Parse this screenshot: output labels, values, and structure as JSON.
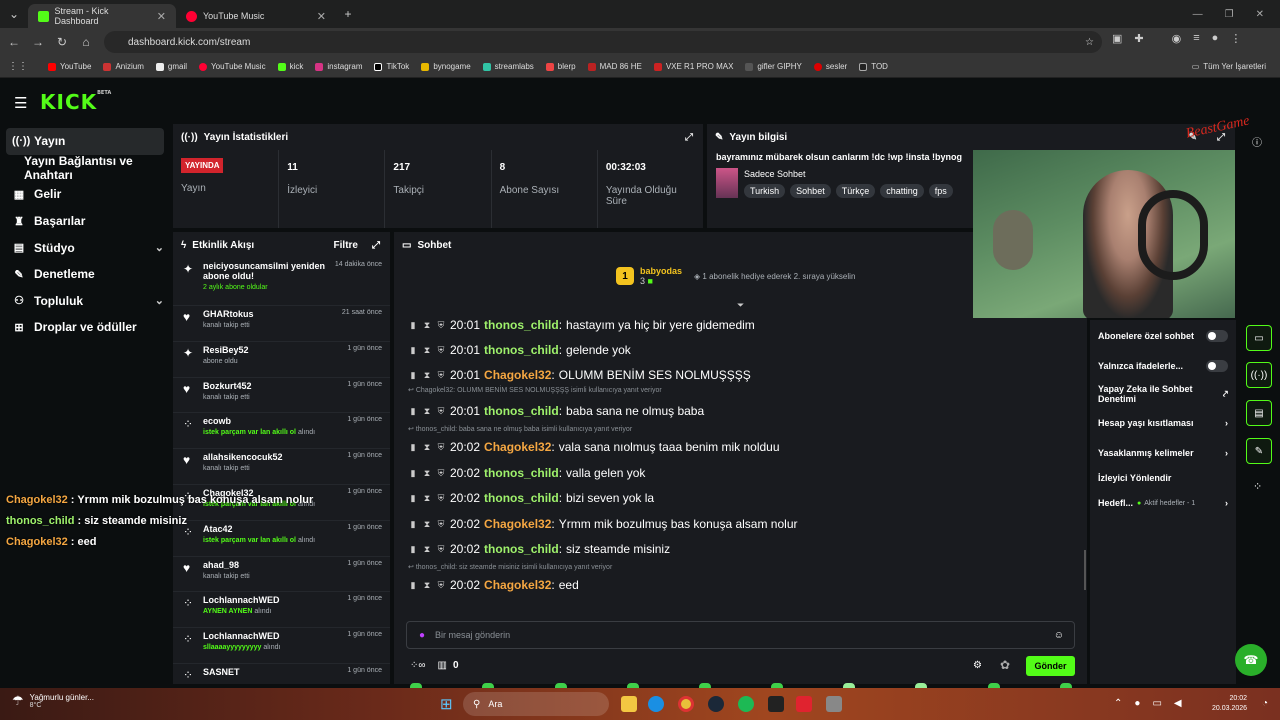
{
  "browser": {
    "tabs": [
      {
        "title": "Stream - Kick Dashboard"
      },
      {
        "title": "YouTube Music"
      }
    ],
    "url": "dashboard.kick.com/stream",
    "bookmarks": [
      "YouTube",
      "Anizium",
      "gmail",
      "YouTube Music",
      "kick",
      "instagram",
      "TikTok",
      "bynogame",
      "streamlabs",
      "blerp",
      "MAD 86 HE",
      "VXE R1 PRO MAX",
      "gifler GIPHY",
      "sesler",
      "TOD"
    ],
    "all_bookmarks": "Tüm Yer İşaretleri"
  },
  "logo": {
    "text": "KICK",
    "beta": "BETA"
  },
  "nav": {
    "items": [
      {
        "label": "Yayın",
        "icon": "broadcast-icon"
      },
      {
        "label": "Yayın Bağlantısı ve Anahtarı",
        "icon": ""
      },
      {
        "label": "Gelir",
        "icon": "revenue-icon"
      },
      {
        "label": "Başarılar",
        "icon": "trophy-icon"
      },
      {
        "label": "Stüdyo",
        "icon": "studio-icon"
      },
      {
        "label": "Denetleme",
        "icon": "wrench-icon"
      },
      {
        "label": "Topluluk",
        "icon": "community-icon"
      },
      {
        "label": "Droplar ve ödüller",
        "icon": "gift-icon"
      }
    ]
  },
  "stats": {
    "title": "Yayın İstatistikleri",
    "live_badge": "YAYINDA",
    "live_label": "Yayın",
    "viewers": "11",
    "viewers_label": "İzleyici",
    "followers": "217",
    "followers_label": "Takipçi",
    "subs": "8",
    "subs_label": "Abone Sayısı",
    "uptime": "00:32:03",
    "uptime_label": "Yayında Olduğu Süre"
  },
  "stream_info": {
    "title": "Yayın bilgisi",
    "stream_title": "bayramınız mübarek olsun canlarım !dc !wp !insta !bynog",
    "category": "Sadece Sohbet",
    "tags": [
      "Turkish",
      "Sohbet",
      "Türkçe",
      "chatting",
      "fps"
    ]
  },
  "feed": {
    "title": "Etkinlik Akışı",
    "filter": "Filtre",
    "items": [
      {
        "name": "neiciyosuncamsilmi yeniden abone oldu!",
        "sub": "2 aylık abone oldular",
        "time": "14 dakika önce",
        "green": true
      },
      {
        "name": "GHARtokus",
        "sub": "kanalı takip etti",
        "time": "21 saat önce"
      },
      {
        "name": "ResiBey52",
        "sub": "abone oldu",
        "time": "1 gün önce"
      },
      {
        "name": "Bozkurt452",
        "sub": "kanalı takip etti",
        "time": "1 gün önce"
      },
      {
        "name": "ecowb",
        "sub_green": "istek parçam var lan akıllı ol",
        "sub_rest": " alındı",
        "time": "1 gün önce"
      },
      {
        "name": "allahsikencocuk52",
        "sub": "kanalı takip etti",
        "time": "1 gün önce"
      },
      {
        "name": "Chagokel32",
        "sub_green": "istek parçam var lan akıllı ol",
        "sub_rest": " alındı",
        "time": "1 gün önce"
      },
      {
        "name": "Atac42",
        "sub_green": "istek parçam var lan akıllı ol",
        "sub_rest": " alındı",
        "time": "1 gün önce"
      },
      {
        "name": "ahad_98",
        "sub": "kanalı takip etti",
        "time": "1 gün önce"
      },
      {
        "name": "LochlannachWED",
        "sub_green": "AYNEN AYNEN",
        "sub_rest": " alındı",
        "time": "1 gün önce"
      },
      {
        "name": "LochlannachWED",
        "sub_green": "sllaaaayyyyyyyyy",
        "sub_rest": " alındı",
        "time": "1 gün önce"
      },
      {
        "name": "SASNET",
        "sub": "",
        "time": "1 gün önce"
      }
    ]
  },
  "chat": {
    "title": "Sohbet",
    "top_gifter": {
      "name": "babyodas",
      "count": "3",
      "rank": "1",
      "note": "1 abonelik hediye ederek 2. sıraya yükselin"
    },
    "messages": [
      {
        "time": "20:01",
        "user": "thonos_child",
        "color": "green",
        "text": "hastayım ya hiç bir yere gidemedim"
      },
      {
        "time": "20:01",
        "user": "thonos_child",
        "color": "green",
        "text": "gelende yok"
      },
      {
        "time": "20:01",
        "user": "Chagokel32",
        "color": "orange",
        "text": "OLUMM BENİM SES NOLMUŞŞŞŞ"
      },
      {
        "reply": "Chagokel32: OLUMM BENİM SES NOLMUŞŞŞŞ isimli kullanıcıya yanıt veriyor"
      },
      {
        "time": "20:01",
        "user": "thonos_child",
        "color": "green",
        "text": "baba sana ne olmuş baba"
      },
      {
        "reply": "thonos_child: baba sana ne olmuş baba isimli kullanıcıya yanıt veriyor"
      },
      {
        "time": "20:02",
        "user": "Chagokel32",
        "color": "orange",
        "text": "vala sana nıolmuş taaa benim mik nolduu"
      },
      {
        "time": "20:02",
        "user": "thonos_child",
        "color": "green",
        "text": "valla gelen yok"
      },
      {
        "time": "20:02",
        "user": "thonos_child",
        "color": "green",
        "text": "bizi seven yok la"
      },
      {
        "time": "20:02",
        "user": "Chagokel32",
        "color": "orange",
        "text": "Yrmm mik bozulmuş bas konuşa alsam nolur"
      },
      {
        "time": "20:02",
        "user": "thonos_child",
        "color": "green",
        "text": "siz steamde misiniz"
      },
      {
        "reply": "thonos_child: siz steamde misiniz isimli kullanıcıya yanıt veriyor"
      },
      {
        "time": "20:02",
        "user": "Chagokel32",
        "color": "orange",
        "text": "eed"
      }
    ],
    "placeholder": "Bir mesaj gönderin",
    "points": "0",
    "send": "Gönder"
  },
  "settings": {
    "sub_only": "Abonelere özel sohbet",
    "emote_only": "Yalnızca ifadelerle...",
    "ai_mod": "Yapay Zeka ile Sohbet Denetimi",
    "age": "Hesap yaşı kısıtlaması",
    "banned_words": "Yasaklanmış kelimeler",
    "redirect": "İzleyici Yönlendir",
    "goals": "Hedefl...",
    "goals_status": "Aktif hedefler - 1"
  },
  "overlay": [
    {
      "user": "Chagokel32",
      "text": "Yrmm mik bozulmuş bas konuşa alsam nolur"
    },
    {
      "user": "thonos_child",
      "text": "siz steamde misiniz"
    },
    {
      "user": "Chagokel32",
      "text": "eed"
    }
  ],
  "taskbar": {
    "weather": "Yağmurlu günler...",
    "temp": "8°C",
    "search": "Ara",
    "time": "20:02",
    "date": "20.03.2026"
  }
}
